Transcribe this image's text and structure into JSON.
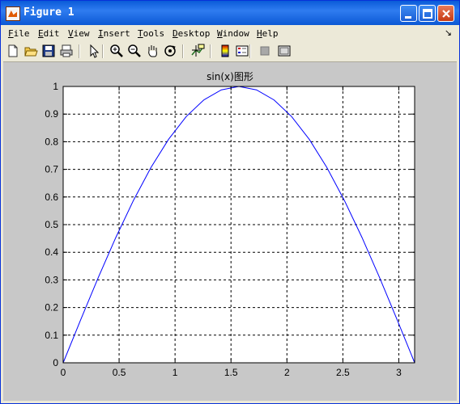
{
  "window": {
    "title": "Figure 1"
  },
  "menu": [
    {
      "label": "File",
      "u": "F",
      "rest": "ile"
    },
    {
      "label": "Edit",
      "u": "E",
      "rest": "dit"
    },
    {
      "label": "View",
      "u": "V",
      "rest": "iew"
    },
    {
      "label": "Insert",
      "u": "I",
      "rest": "nsert"
    },
    {
      "label": "Tools",
      "u": "T",
      "rest": "ools"
    },
    {
      "label": "Desktop",
      "u": "D",
      "rest": "esktop"
    },
    {
      "label": "Window",
      "u": "W",
      "rest": "indow"
    },
    {
      "label": "Help",
      "u": "H",
      "rest": "elp"
    }
  ],
  "toolbar": {
    "icons": [
      "new-file-icon",
      "open-folder-icon",
      "save-icon",
      "print-icon",
      "pointer-icon",
      "zoom-in-icon",
      "zoom-out-icon",
      "pan-hand-icon",
      "rotate-3d-icon",
      "data-cursor-icon",
      "colorbar-icon",
      "legend-icon",
      "hide-plot-tools-icon",
      "show-plot-tools-icon"
    ]
  },
  "colors": {
    "line": "#0000ff",
    "title_bg": "#0a5bd8",
    "figure_bg": "#c8c8c8"
  },
  "chart_data": {
    "type": "line",
    "title": "sin(x)图形",
    "xlabel": "",
    "ylabel": "",
    "xlim": [
      0,
      3.1416
    ],
    "ylim": [
      0,
      1
    ],
    "xticks": [
      0,
      0.5,
      1,
      1.5,
      2,
      2.5,
      3
    ],
    "yticks": [
      0,
      0.1,
      0.2,
      0.3,
      0.4,
      0.5,
      0.6,
      0.7,
      0.8,
      0.9,
      1
    ],
    "grid": true,
    "series": [
      {
        "x": [
          0,
          0.1571,
          0.3142,
          0.4712,
          0.6283,
          0.7854,
          0.9425,
          1.0996,
          1.2566,
          1.4137,
          1.5708,
          1.7279,
          1.885,
          2.042,
          2.1991,
          2.3562,
          2.5133,
          2.6704,
          2.8274,
          2.9845,
          3.1416
        ],
        "y": [
          0,
          0.1564,
          0.309,
          0.454,
          0.5878,
          0.7071,
          0.809,
          0.891,
          0.9511,
          0.9877,
          1,
          0.9877,
          0.9511,
          0.891,
          0.809,
          0.7071,
          0.5878,
          0.454,
          0.309,
          0.1564,
          0
        ]
      }
    ]
  }
}
